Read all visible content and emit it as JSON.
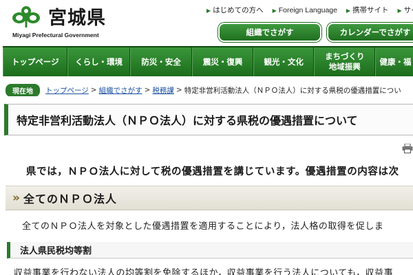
{
  "header": {
    "logo_title": "宮城県",
    "logo_subtitle": "Miyagi Prefectural Government",
    "util_links": [
      {
        "label": "はじめての方へ"
      },
      {
        "label": "Foreign Language"
      },
      {
        "label": "携帯サイト"
      },
      {
        "label": "サイ"
      }
    ],
    "org_button": "組織でさがす",
    "calendar_button": "カレンダーでさがす"
  },
  "gnav": {
    "items": [
      "トップページ",
      "くらし・環境",
      "防災・安全",
      "震災・復興",
      "観光・文化",
      "まちづくり\n地域振興",
      "健康・福"
    ]
  },
  "breadcrumb": {
    "here_label": "現在地",
    "links": [
      "トップページ",
      "組織でさがす",
      "税務課"
    ],
    "separator": ">",
    "current": "特定非営利活動法人（ＮＰＯ法人）に対する県税の優遇措置につい"
  },
  "page": {
    "title": "特定非営利活動法人（ＮＰＯ法人）に対する県税の優遇措置について",
    "lead": "県では，ＮＰＯ法人に対して税の優遇措置を講じています。優遇措置の内容は次",
    "h2_mark": "»",
    "h2": "全てのＮＰＯ法人",
    "para1": "全てのＮＰＯ法人を対象とした優遇措置を適用することにより，法人格の取得を促しま",
    "h3": "法人県民税均等割",
    "para2": "収益事業を行わない法人の均等割を免除するほか，収益事業を行う法人についても，収益事"
  },
  "colors": {
    "brand_green": "#2c7a2c",
    "nav_green": "#1d6b1d",
    "link_blue": "#1a4fa0"
  },
  "icons": {
    "logo": "miyagi-logo-mark",
    "print": "print-icon"
  }
}
